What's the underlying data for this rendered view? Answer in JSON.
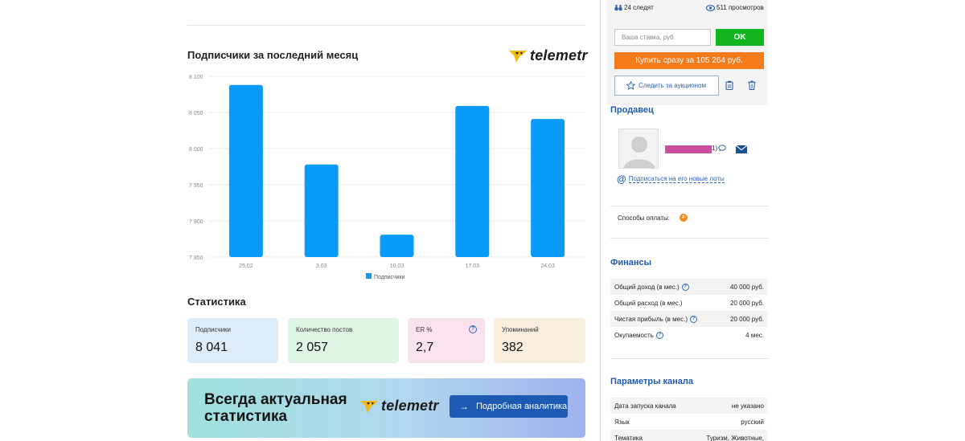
{
  "chart_card": {
    "title": "Подписчики за последний месяц",
    "logo_text": "telemetr"
  },
  "chart_data": {
    "type": "bar",
    "categories": [
      "25.02",
      "3.03",
      "10.03",
      "17.03",
      "24.03"
    ],
    "series": [
      {
        "name": "Подписчики",
        "values": [
          8088,
          7978,
          7881,
          8059,
          8041
        ]
      }
    ],
    "ylim": [
      7850,
      8100
    ],
    "yticks": [
      "8 100",
      "8 050",
      "8 000",
      "7 950",
      "7 900",
      "7 850"
    ],
    "ytick_values": [
      8100,
      8050,
      8000,
      7950,
      7900,
      7850
    ],
    "grid": true,
    "legend_position": "bottom",
    "bar_color": "#0a9af7"
  },
  "stats": {
    "title": "Статистика",
    "cards": [
      {
        "label": "Подписчики",
        "value": "8 041",
        "bg": "#dcecf8"
      },
      {
        "label": "Количество постов",
        "value": "2 057",
        "bg": "#def5e5"
      },
      {
        "label": "ER %",
        "value": "2,7",
        "bg": "#fbe2ef"
      },
      {
        "label": "Упоминаний",
        "value": "382",
        "bg": "#faefde"
      }
    ],
    "help_icon": "?"
  },
  "banner": {
    "title": "Всегда актуальная статистика",
    "logo_text": "telemetr",
    "button_label": "Подробная аналитика"
  },
  "auction": {
    "followers": "24 следят",
    "views": "511 просмотров",
    "bid_placeholder": "Ваша ставка, руб.",
    "ok_label": "OK",
    "buy_label": "Купить сразу за 105 264 руб.",
    "follow_label": "Следить за аукционом"
  },
  "seller": {
    "title": "Продавец",
    "name_suffix": "1)",
    "subscribe_label": "Подписаться на его новые лоты",
    "payment_label": "Способы оплаты:",
    "payment_icon": "P"
  },
  "finances": {
    "title": "Финансы",
    "rows": [
      {
        "label": "Общий доход (в мес.)",
        "value": "40 000 руб.",
        "help": true
      },
      {
        "label": "Общий расход (в мес.)",
        "value": "20 000 руб.",
        "help": false
      },
      {
        "label": "Чистая прибыль (в мес.)",
        "value": "20 000 руб.",
        "help": true
      },
      {
        "label": "Окупаемость",
        "value": "4 мес.",
        "help": true
      }
    ]
  },
  "channel": {
    "title": "Параметры канала",
    "rows": [
      {
        "label": "Дата запуска канала",
        "value": "не указано"
      },
      {
        "label": "Язык",
        "value": "русский"
      },
      {
        "label": "Тематика",
        "value": "Туризм, Животные,"
      }
    ]
  },
  "colors": {
    "accent_blue": "#1e5ab2",
    "ok_green": "#12b51e",
    "buy_orange": "#f47b1c",
    "seller_name_redacted": "#c950a1"
  }
}
